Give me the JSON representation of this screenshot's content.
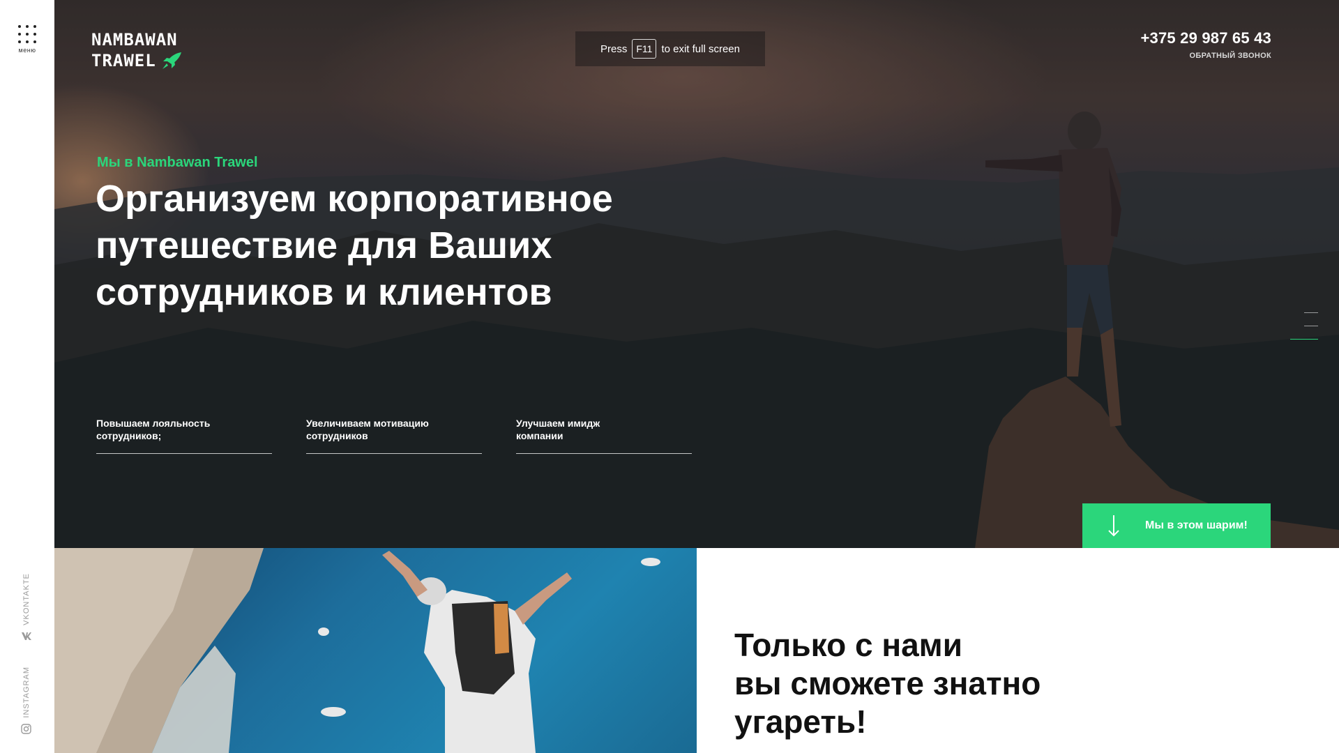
{
  "rail": {
    "menu_label": "меню",
    "social": [
      {
        "label": "VKONTAKTE",
        "icon": "vk-icon"
      },
      {
        "label": "INSTAGRAM",
        "icon": "instagram-icon"
      }
    ]
  },
  "header": {
    "logo": {
      "line1": "NAMBAWAN",
      "line2": "TRAWEL",
      "icon": "rocket-icon"
    },
    "phone": "+375 29 987 65 43",
    "callback": "ОБРАТНЫЙ ЗВОНОК"
  },
  "fullscreen_notice": {
    "press": "Press",
    "key": "F11",
    "rest": "to exit full screen"
  },
  "hero": {
    "eyebrow": "Мы в Nambawan Trawel",
    "headline_lines": [
      "Организуем корпоративное",
      "путешествие для Ваших",
      "сотрудников и клиентов"
    ],
    "features": [
      {
        "line1": "Повышаем лояльность",
        "line2": "сотрудников;"
      },
      {
        "line1": "Увеличиваем мотивацию",
        "line2": "сотрудников"
      },
      {
        "line1": "Улучшаем имидж",
        "line2": "компании"
      }
    ],
    "cta": {
      "label": "Мы в этом шарим!",
      "icon": "arrow-down-icon"
    }
  },
  "lower": {
    "lines": [
      "Только с нами",
      "вы сможете знатно",
      "угареть!"
    ]
  },
  "colors": {
    "accent": "#2bd67b",
    "text_dark": "#111111",
    "white": "#ffffff"
  }
}
